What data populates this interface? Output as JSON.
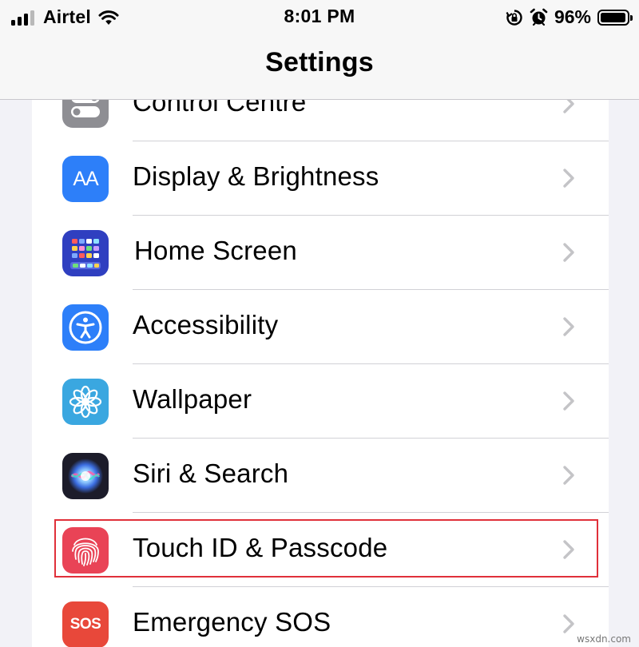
{
  "status_bar": {
    "carrier": "Airtel",
    "time": "8:01 PM",
    "battery_percent": "96%",
    "signal_bars": 4,
    "signal_bars_filled": 3,
    "battery_level": 0.96
  },
  "nav": {
    "title": "Settings"
  },
  "settings_items": [
    {
      "id": "control-centre",
      "label": "Control Centre",
      "icon": "toggle-switch-icon",
      "icon_color": "#8e8e93"
    },
    {
      "id": "display-brightness",
      "label": "Display & Brightness",
      "icon": "text-size-icon",
      "icon_text": "AA",
      "icon_color": "#2d7ff9"
    },
    {
      "id": "home-screen",
      "label": "Home Screen",
      "icon": "app-grid-icon",
      "icon_color": "#2f3fc0"
    },
    {
      "id": "accessibility",
      "label": "Accessibility",
      "icon": "accessibility-person-icon",
      "icon_color": "#2d7ff9"
    },
    {
      "id": "wallpaper",
      "label": "Wallpaper",
      "icon": "flower-icon",
      "icon_color": "#3aa7e0"
    },
    {
      "id": "siri-search",
      "label": "Siri & Search",
      "icon": "siri-orb-icon",
      "icon_color": "#1c1c2a"
    },
    {
      "id": "touch-id-passcode",
      "label": "Touch ID & Passcode",
      "icon": "fingerprint-icon",
      "icon_color": "#e94356",
      "highlighted": true
    },
    {
      "id": "emergency-sos",
      "label": "Emergency SOS",
      "icon": "sos-icon",
      "icon_text": "SOS",
      "icon_color": "#e8483a"
    }
  ],
  "watermark": "wsxdn.com",
  "colors": {
    "highlight": "#e0303a",
    "chevron": "#c4c4c7",
    "separator": "#d1d1d6"
  }
}
